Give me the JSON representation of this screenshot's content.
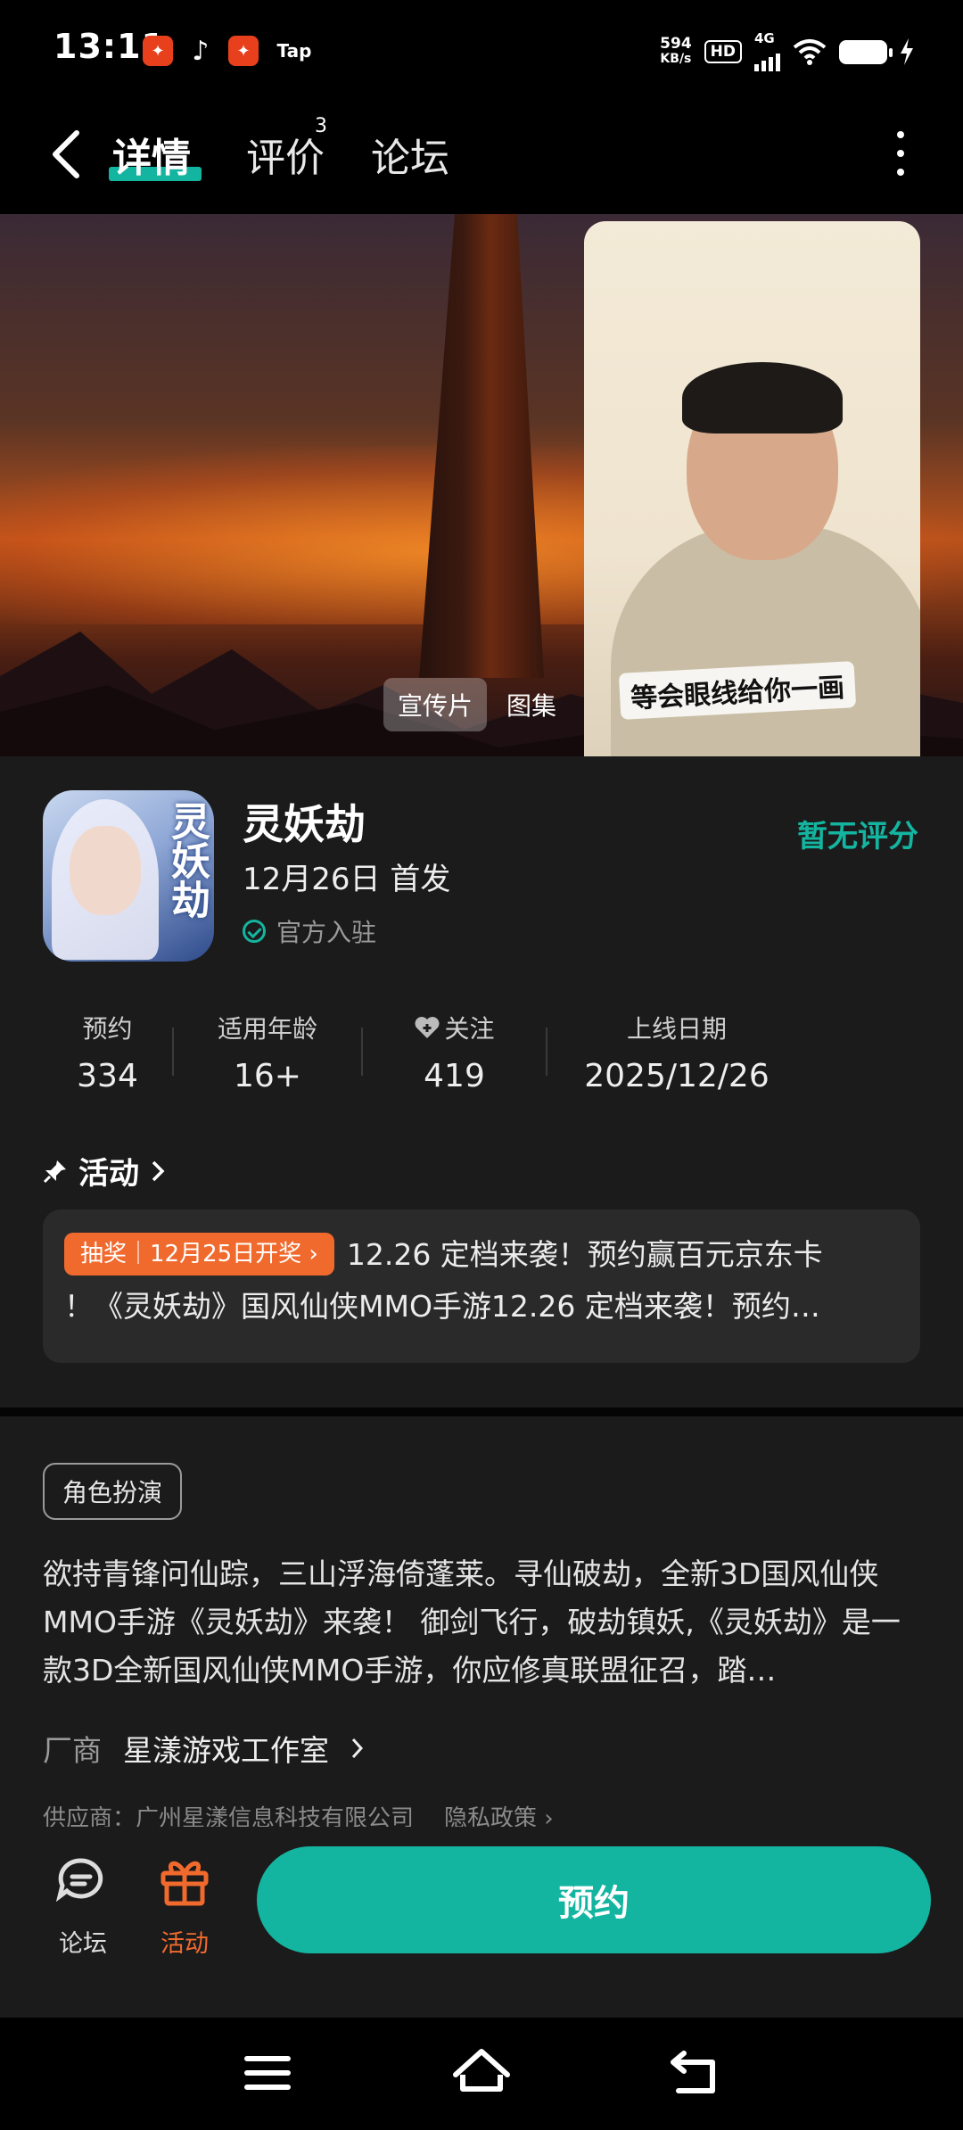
{
  "status_bar": {
    "time": "13:11",
    "tap_label": "Tap",
    "net_speed_value": "594",
    "net_speed_unit": "KB/s",
    "hd": "HD",
    "network": "4G"
  },
  "nav": {
    "tabs": [
      {
        "label": "详情",
        "active": true
      },
      {
        "label": "评价",
        "badge": "3"
      },
      {
        "label": "论坛"
      }
    ]
  },
  "hero": {
    "tags": [
      "宣传片",
      "图集"
    ]
  },
  "pip": {
    "caption": "等会眼线给你一画"
  },
  "game": {
    "title": "灵妖劫",
    "icon_text": "灵妖劫",
    "release": "12月26日 首发",
    "official": "官方入驻",
    "rating_text": "暂无评分"
  },
  "stats": [
    {
      "label": "预约",
      "value": "334"
    },
    {
      "label": "适用年龄",
      "value": "16+"
    },
    {
      "label": "关注",
      "value": "419"
    },
    {
      "label": "上线日期",
      "value": "2025/12/26"
    }
  ],
  "activity": {
    "heading": "活动",
    "pill": "抽奖｜12月25日开奖",
    "text_line1": "12.26 定档来袭！预约赢百元京东卡",
    "text_line2": "！《灵妖劫》国风仙侠MMO手游12.26 定档来袭！预约…"
  },
  "description": {
    "genre": "角色扮演",
    "text": "欲持青锋问仙踪，三山浮海倚蓬莱。寻仙破劫，全新3D国风仙侠MMO手游《灵妖劫》来袭！ 御剑飞行，破劫镇妖,《灵妖劫》是一款3D全新国风仙侠MMO手游，你应修真联盟征召，踏…",
    "vendor_key": "厂商",
    "vendor_value": "星漾游戏工作室",
    "supplier": "供应商：广州星漾信息科技有限公司",
    "privacy": "隐私政策"
  },
  "action_bar": {
    "forum_label": "论坛",
    "activity_label": "活动",
    "reserve_label": "预约"
  },
  "colors": {
    "accent": "#14b5a0",
    "orange": "#f06a2e",
    "background": "#1b1b1b"
  }
}
